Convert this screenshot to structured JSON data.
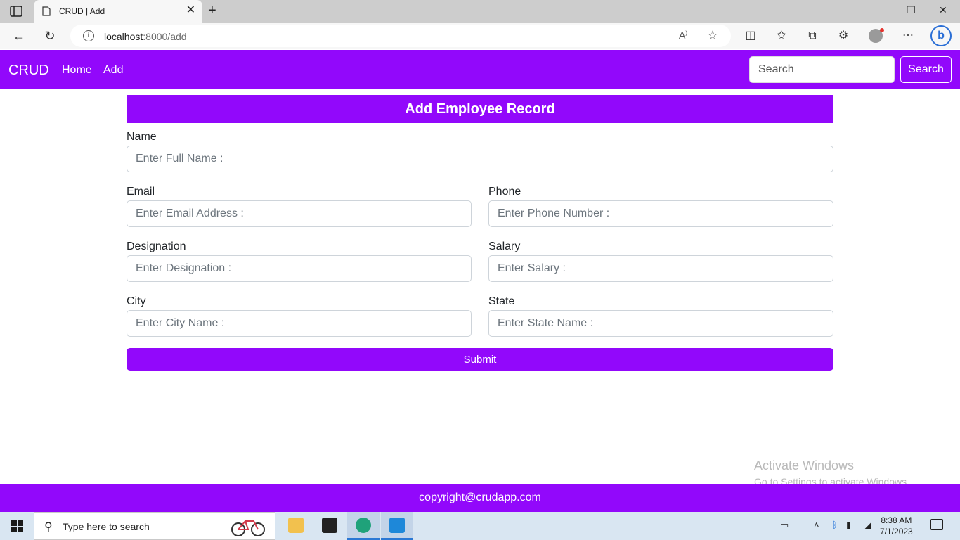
{
  "browser": {
    "tab_title": "CRUD | Add",
    "url_host": "localhost",
    "url_path": ":8000/add",
    "new_tab": "+",
    "tab_close": "✕",
    "window_controls": [
      "—",
      "❐",
      "✕"
    ],
    "toolbar_icons": [
      "split-screen-icon",
      "favorites-icon",
      "collections-icon",
      "extensions-icon",
      "profile-icon",
      "more-icon",
      "bing-icon"
    ]
  },
  "navbar": {
    "brand": "CRUD",
    "links": [
      "Home",
      "Add"
    ],
    "search_placeholder": "Search",
    "search_button": "Search"
  },
  "form": {
    "title": "Add Employee Record",
    "fields": {
      "name": {
        "label": "Name",
        "placeholder": "Enter Full Name :"
      },
      "email": {
        "label": "Email",
        "placeholder": "Enter Email Address :"
      },
      "phone": {
        "label": "Phone",
        "placeholder": "Enter Phone Number :"
      },
      "designation": {
        "label": "Designation",
        "placeholder": "Enter Designation :"
      },
      "salary": {
        "label": "Salary",
        "placeholder": "Enter Salary :"
      },
      "city": {
        "label": "City",
        "placeholder": "Enter City Name :"
      },
      "state": {
        "label": "State",
        "placeholder": "Enter State Name :"
      }
    },
    "submit": "Submit"
  },
  "watermark": {
    "line1": "Activate Windows",
    "line2": "Go to Settings to activate Windows."
  },
  "footer": {
    "text": "copyright@crudapp.com"
  },
  "taskbar": {
    "search_placeholder": "Type here to search",
    "apps": [
      "file-explorer-icon",
      "store-icon",
      "edge-icon",
      "vscode-icon"
    ],
    "time": "8:38 AM",
    "date": "7/1/2023"
  },
  "colors": {
    "primary": "#9208fb"
  }
}
